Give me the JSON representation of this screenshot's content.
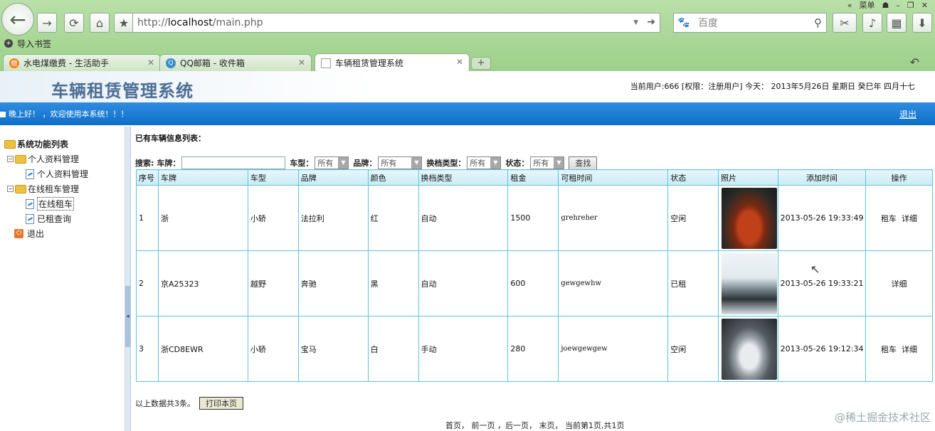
{
  "browser": {
    "menu_label": "菜单",
    "url_prefix": "http://",
    "url_host": "localhost",
    "url_path": "/main.php",
    "search_placeholder": "百度",
    "bookmark_label": "导入书签",
    "tabs": [
      {
        "label": "水电煤缴费 - 生活助手"
      },
      {
        "label": "QQ邮箱 - 收件箱"
      },
      {
        "label": "车辆租赁管理系统"
      }
    ]
  },
  "header": {
    "title": "车辆租赁管理系统",
    "user_info": "当前用户:666 [权限：注册用户] 今天： 2013年5月26日 星期日 癸巳年 四月十七",
    "greeting": "晚上好！ ，欢迎使用本系统！！！",
    "logout_label": "退出"
  },
  "sidebar": {
    "root_label": "系统功能列表",
    "groups": [
      {
        "label": "个人资料管理",
        "items": [
          {
            "label": "个人资料管理"
          }
        ]
      },
      {
        "label": "在线租车管理",
        "items": [
          {
            "label": "在线租车"
          },
          {
            "label": "已租查询"
          }
        ]
      }
    ],
    "exit_label": "退出"
  },
  "main": {
    "list_title": "已有车辆信息列表：",
    "search": {
      "label": "搜索:",
      "plate_label": "车牌：",
      "type_label": "车型：",
      "type_value": "所有",
      "brand_label": "品牌：",
      "brand_value": "所有",
      "gear_label": "换档类型：",
      "gear_value": "所有",
      "status_label": "状态：",
      "status_value": "所有",
      "button_label": "查找"
    },
    "columns": [
      "序号",
      "车牌",
      "车型",
      "品牌",
      "颜色",
      "换档类型",
      "租金",
      "可租时间",
      "状态",
      "照片",
      "添加时间",
      "操作"
    ],
    "rows": [
      {
        "no": "1",
        "plate": "浙",
        "type": "小轿",
        "brand": "法拉利",
        "color": "红",
        "gear": "自动",
        "rent": "1500",
        "rentable": "grehreher",
        "status": "空闲",
        "added": "2013-05-26 19:33:49",
        "op_rent": "租车",
        "op_detail": "详细"
      },
      {
        "no": "2",
        "plate": "京A25323",
        "type": "越野",
        "brand": "奔驰",
        "color": "黑",
        "gear": "自动",
        "rent": "600",
        "rentable": "gewgewhw",
        "status": "已租",
        "added": "2013-05-26 19:33:21",
        "op_rent": "",
        "op_detail": "详细"
      },
      {
        "no": "3",
        "plate": "浙CD8EWR",
        "type": "小轿",
        "brand": "宝马",
        "color": "白",
        "gear": "手动",
        "rent": "280",
        "rentable": "joewgewgew",
        "status": "空闲",
        "added": "2013-05-26 19:12:34",
        "op_rent": "租车",
        "op_detail": "详细"
      }
    ],
    "total_text": "以上数据共3条。",
    "print_label": "打印本页",
    "pager_text": "首页， 前一页 ，后一页， 末页， 当前第1页,共1页"
  },
  "watermark": "@稀土掘金技术社区"
}
